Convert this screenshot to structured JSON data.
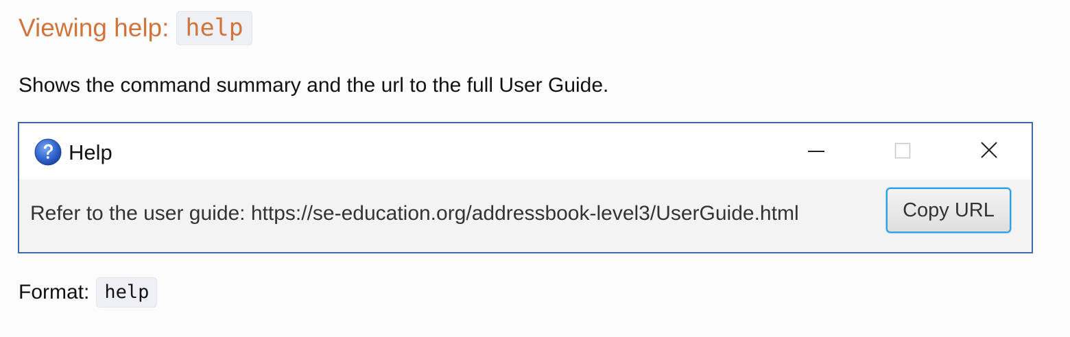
{
  "section": {
    "heading_text": "Viewing help:",
    "heading_code": "help",
    "heading_color": "#d0743c",
    "description": "Shows the command summary and the url to the full User Guide."
  },
  "help_window": {
    "title": "Help",
    "icon": "question-mark-icon",
    "controls": [
      "minimize-icon",
      "maximize-icon",
      "close-icon"
    ],
    "guide_text": "Refer to the user guide: https://se-education.org/addressbook-level3/UserGuide.html",
    "copy_button_label": "Copy URL",
    "border_color": "#3a6aa8",
    "button_focus_color": "#2f9fe0"
  },
  "format": {
    "label": "Format:",
    "code": "help"
  }
}
